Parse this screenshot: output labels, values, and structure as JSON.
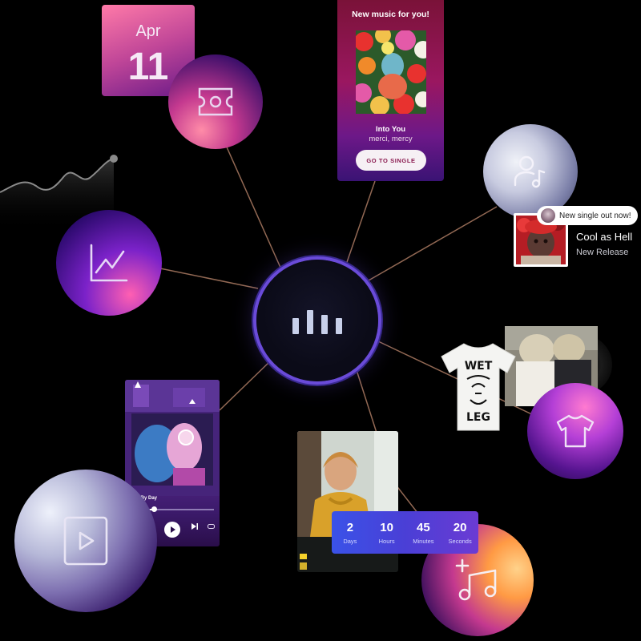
{
  "date_card": {
    "month": "Apr",
    "day": "11"
  },
  "new_music_card": {
    "header": "New music for you!",
    "song": "Into You",
    "artist": "merci, mercy",
    "button": "GO TO SINGLE"
  },
  "artist_notification": {
    "badge": "New single out now!",
    "release_title": "Cool as Hell",
    "release_subtitle": "New Release"
  },
  "player_card": {
    "track": "Day By Day",
    "artist": "",
    "progress": 0.28
  },
  "video_card": {
    "caption": "",
    "channel": "",
    "uploader": ""
  },
  "countdown": {
    "units": [
      {
        "value": "2",
        "label": "Days"
      },
      {
        "value": "10",
        "label": "Hours"
      },
      {
        "value": "45",
        "label": "Minutes"
      },
      {
        "value": "20",
        "label": "Seconds"
      }
    ]
  },
  "merch": {
    "tshirt_print_top": "WET",
    "tshirt_print_bottom": "LEG"
  },
  "nodes": {
    "hub": "bars-icon",
    "top_left": "ticket-icon",
    "left": "line-chart-icon",
    "right_top": "artist-note-icon",
    "right_bottom": "tshirt-icon",
    "bottom_left": "play-video-icon",
    "bottom_right": "add-music-icon"
  },
  "colors": {
    "background": "#000000",
    "connector": "#b8846a",
    "accent": "#6a4bd8"
  }
}
